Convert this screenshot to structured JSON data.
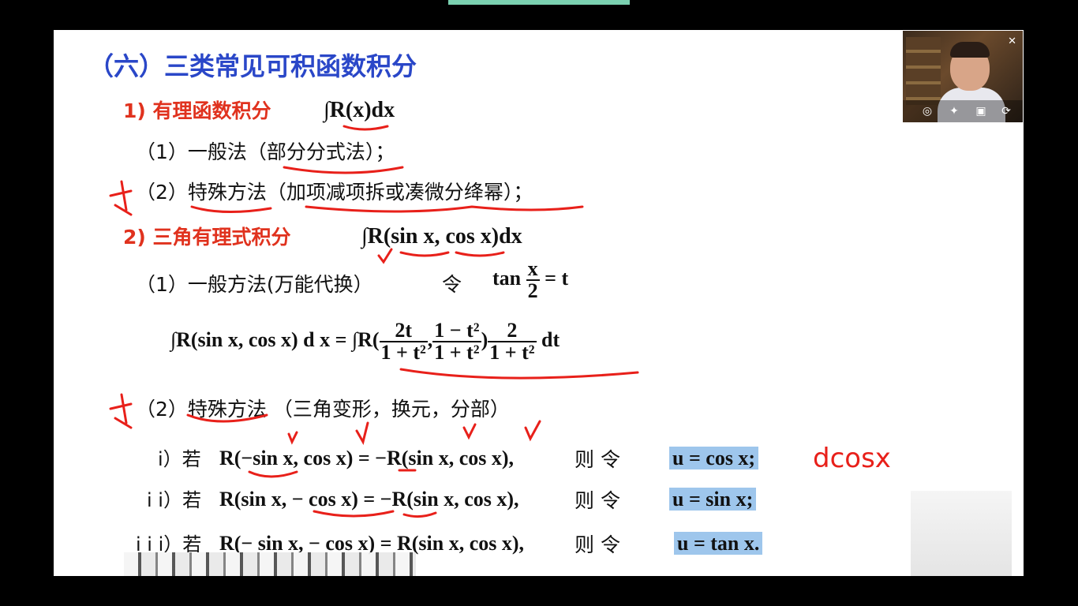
{
  "title": "（六）三类常见可积函数积分",
  "sec1": {
    "label": "1) 有理函数积分",
    "formula": "∫R(x)dx",
    "item1": "（1）一般法（部分分式法）；",
    "item2": "（2）特殊方法（加项减项拆或凑微分绛幂）；"
  },
  "sec2": {
    "label": "2) 三角有理式积分",
    "formula": "∫R(sin x, cos x)dx",
    "item1": "（1）一般方法(万能代换）",
    "ling": "令",
    "subst_lhs": "tan",
    "subst_num": "x",
    "subst_den": "2",
    "subst_rhs": "= t",
    "big_lhs": "∫R(sin x, cos x) d x = ∫R(",
    "f1_num": "2t",
    "f1_den": "1 + t²",
    "f2_num": "1 − t²",
    "f2_den": "1 + t²",
    "f3_num": "2",
    "f3_den": "1 + t²",
    "big_tail": "dt",
    "item2": "（2）特殊方法 （三角变形，换元，分部）"
  },
  "cases": [
    {
      "label": "i）若",
      "eq": "R(−sin x, cos x) = −R(sin x, cos x),",
      "ze": "则 令",
      "sub": "u = cos x;"
    },
    {
      "label": "i i）若",
      "eq": "R(sin x, − cos x) = −R(sin x, cos x),",
      "ze": "则 令",
      "sub": "u = sin x;"
    },
    {
      "label": "i i i）若",
      "eq": "R(− sin x, − cos x) = R(sin x, cos x),",
      "ze": "则 令",
      "sub": "u = tan x."
    }
  ],
  "annotation_dcosx": "dcosx",
  "colors": {
    "title": "#2a47c8",
    "section": "#e0321e",
    "highlight": "#9ec6ec",
    "ink": "#e8201a"
  }
}
